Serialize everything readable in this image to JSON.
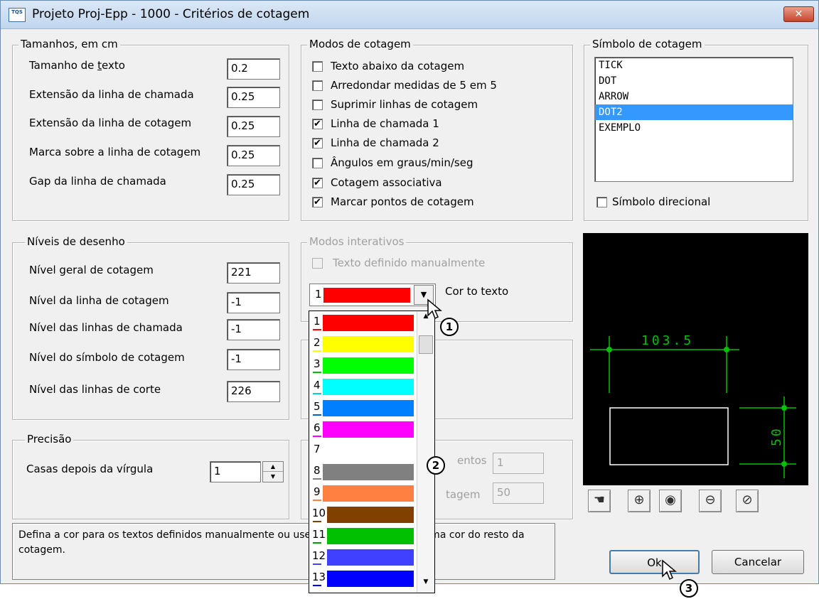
{
  "window": {
    "title": "Projeto Proj-Epp - 1000 - Critérios de cotagem",
    "icon_text": "TQS",
    "close_glyph": "✕"
  },
  "tamanhos": {
    "legend": "Tamanhos, em cm",
    "rows": [
      {
        "label": "Tamanho de texto",
        "value": "0.2"
      },
      {
        "label": "Extensão da linha de chamada",
        "value": "0.25"
      },
      {
        "label": "Extensão da linha de cotagem",
        "value": "0.25"
      },
      {
        "label": "Marca sobre a linha de cotagem",
        "value": "0.25"
      },
      {
        "label": "Gap da linha de chamada",
        "value": "0.25"
      }
    ]
  },
  "modos": {
    "legend": "Modos de cotagem",
    "items": [
      {
        "label": "Texto abaixo da cotagem",
        "checked": false
      },
      {
        "label": "Arredondar medidas de 5 em 5",
        "checked": false
      },
      {
        "label": "Suprimir linhas de cotagem",
        "checked": false
      },
      {
        "label": "Linha de chamada 1",
        "checked": true
      },
      {
        "label": "Linha de chamada 2",
        "checked": true
      },
      {
        "label": "Ângulos em graus/min/seg",
        "checked": false
      },
      {
        "label": "Cotagem associativa",
        "checked": true
      },
      {
        "label": "Marcar pontos de cotagem",
        "checked": true
      }
    ]
  },
  "simbolo": {
    "legend": "Símbolo de cotagem",
    "items": [
      "TICK",
      "DOT",
      "ARROW",
      "DOT2",
      "EXEMPLO"
    ],
    "selected_index": 3,
    "directional_label": "Símbolo direcional",
    "directional_checked": false
  },
  "niveis": {
    "legend": "Níveis de desenho",
    "rows": [
      {
        "label": "Nível geral de cotagem",
        "value": "221"
      },
      {
        "label": "Nível da linha de cotagem",
        "value": "-1"
      },
      {
        "label": "Nível das linhas de chamada",
        "value": "-1"
      },
      {
        "label": "Nível do símbolo de cotagem",
        "value": "-1"
      },
      {
        "label": "Nível das linhas de corte",
        "value": "226"
      }
    ]
  },
  "interativos": {
    "legend": "Modos interativos",
    "manual_text_label": "Texto definido manualmente",
    "color_label": "Cor to texto",
    "selected_color_num": "1",
    "selected_color": "#ff0000"
  },
  "color_options": [
    {
      "num": "1",
      "color": "#ff0000",
      "ul": "#ff0000"
    },
    {
      "num": "2",
      "color": "#ffff00",
      "ul": "#ffff00"
    },
    {
      "num": "3",
      "color": "#00ff00",
      "ul": "#00c000"
    },
    {
      "num": "4",
      "color": "#00ffff",
      "ul": "#00d0d0"
    },
    {
      "num": "5",
      "color": "#0080ff",
      "ul": "#0060d0"
    },
    {
      "num": "6",
      "color": "#ff00ff",
      "ul": "#ff00ff"
    },
    {
      "num": "7",
      "color": "#ffffff",
      "ul": "#ffffff"
    },
    {
      "num": "8",
      "color": "#808080",
      "ul": "#808080"
    },
    {
      "num": "9",
      "color": "#ff8040",
      "ul": "#ff8040"
    },
    {
      "num": "10",
      "color": "#804000",
      "ul": "#804000"
    },
    {
      "num": "11",
      "color": "#00c000",
      "ul": "#00a000"
    },
    {
      "num": "12",
      "color": "#4040ff",
      "ul": "#4040ff"
    },
    {
      "num": "13",
      "color": "#0000ff",
      "ul": "#0000ff"
    }
  ],
  "precisao": {
    "legend": "Precisão",
    "label": "Casas depois da vírgula",
    "value": "1"
  },
  "hidden_fields": {
    "segmentos_partial": "entos",
    "segmentos_value": "1",
    "cotagem_partial": "tagem",
    "cotagem_value": "50"
  },
  "preview": {
    "dim_h": "103.5",
    "dim_v": "50",
    "line_color": "#00c000",
    "rect_color": "#ffffff"
  },
  "zoom_tools": [
    "pan-icon",
    "zoom-window-icon",
    "zoom-all-icon",
    "zoom-out-icon",
    "zoom-previous-icon"
  ],
  "help_text": "Defina a cor para os textos definidos manualmente ou use (-1) para manter a mesma cor do resto da cotagem.",
  "buttons": {
    "ok": "Ok",
    "cancel": "Cancelar"
  },
  "callouts": [
    "1",
    "2",
    "3"
  ]
}
